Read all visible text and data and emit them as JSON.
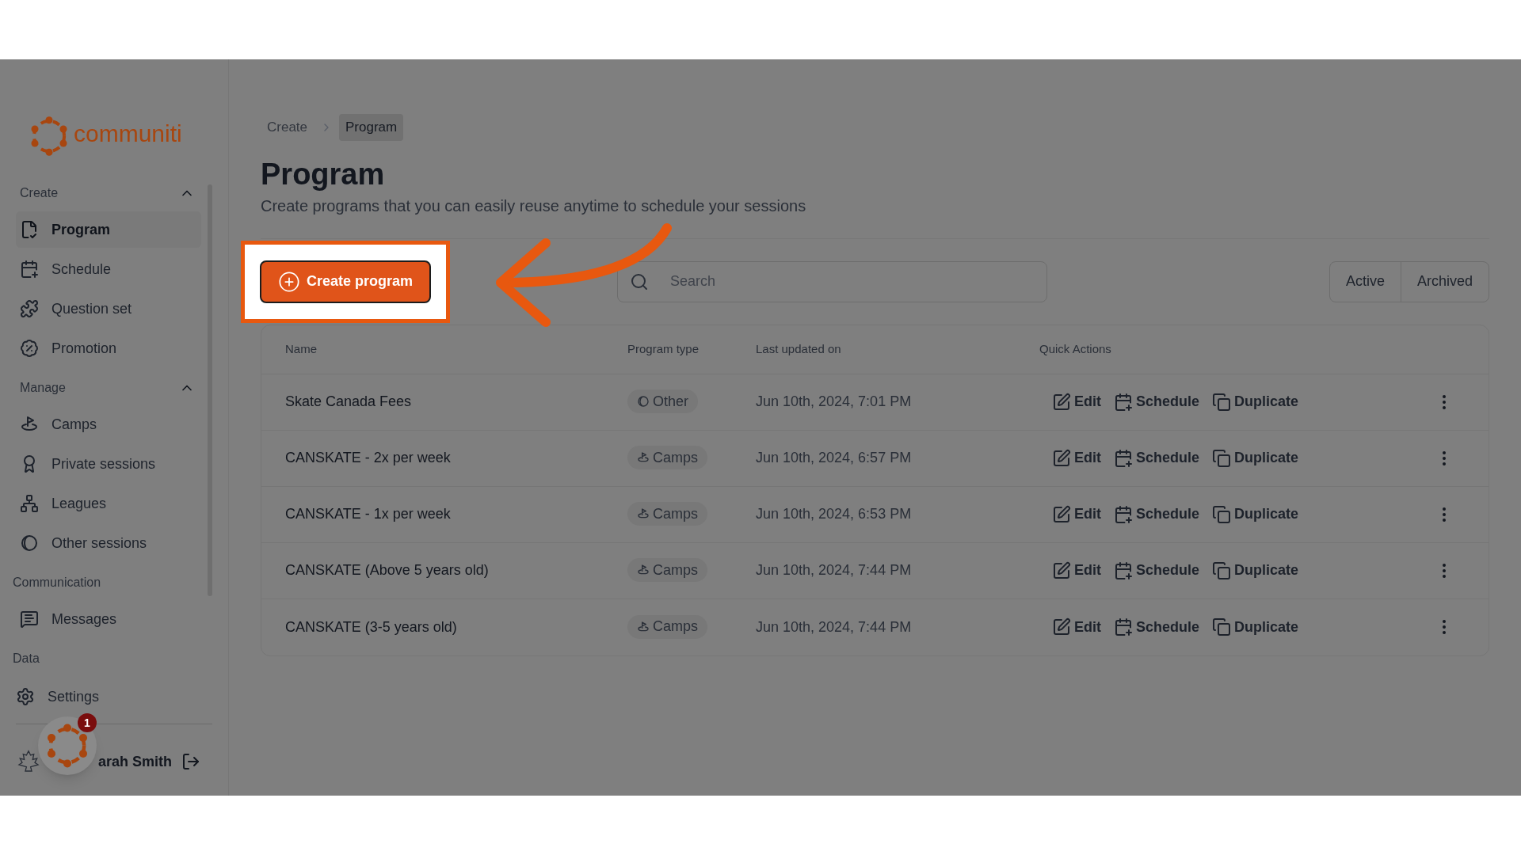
{
  "sidebar": {
    "brand": "communiti",
    "sections": [
      {
        "title": "Create",
        "expanded": true,
        "items": [
          {
            "label": "Program",
            "kind": "program",
            "selected": true
          },
          {
            "label": "Schedule",
            "kind": "schedule",
            "selected": false
          },
          {
            "label": "Question set",
            "kind": "puzzle",
            "selected": false
          },
          {
            "label": "Promotion",
            "kind": "percent",
            "selected": false
          }
        ]
      },
      {
        "title": "Manage",
        "expanded": true,
        "items": [
          {
            "label": "Camps",
            "kind": "camp",
            "selected": false
          },
          {
            "label": "Private sessions",
            "kind": "award",
            "selected": false
          },
          {
            "label": "Leagues",
            "kind": "network",
            "selected": false
          },
          {
            "label": "Other sessions",
            "kind": "half",
            "selected": false
          }
        ]
      },
      {
        "title": "Communication",
        "items": [
          {
            "label": "Messages",
            "kind": "message",
            "selected": false
          }
        ]
      },
      {
        "title": "Data"
      }
    ],
    "settings": "Settings",
    "user": {
      "name": "arah Smith"
    },
    "widget_badge": "1"
  },
  "breadcrumb": [
    {
      "label": "Create",
      "selected": false
    },
    {
      "label": "Program",
      "selected": true
    }
  ],
  "page": {
    "title": "Program",
    "subtitle": "Create programs that you can easily reuse anytime to schedule your sessions"
  },
  "create_button": "Create program",
  "search": {
    "placeholder": "Search"
  },
  "filter_tabs": [
    {
      "label": "Active"
    },
    {
      "label": "Archived"
    }
  ],
  "table": {
    "columns": [
      "Name",
      "Program type",
      "Last updated on",
      "Quick Actions"
    ],
    "rows": [
      {
        "name": "Skate Canada Fees",
        "type": {
          "kind": "other",
          "label": "Other"
        },
        "updated": "Jun 10th, 2024, 7:01 PM",
        "actions": [
          "Edit",
          "Schedule",
          "Duplicate"
        ]
      },
      {
        "name": "CANSKATE - 2x per week",
        "type": {
          "kind": "camps",
          "label": "Camps"
        },
        "updated": "Jun 10th, 2024, 6:57 PM",
        "actions": [
          "Edit",
          "Schedule",
          "Duplicate"
        ]
      },
      {
        "name": "CANSKATE - 1x per week",
        "type": {
          "kind": "camps",
          "label": "Camps"
        },
        "updated": "Jun 10th, 2024, 6:53 PM",
        "actions": [
          "Edit",
          "Schedule",
          "Duplicate"
        ]
      },
      {
        "name": "CANSKATE (Above 5 years old)",
        "type": {
          "kind": "camps",
          "label": "Camps"
        },
        "updated": "Jun 10th, 2024, 7:44 PM",
        "actions": [
          "Edit",
          "Schedule",
          "Duplicate"
        ]
      },
      {
        "name": "CANSKATE (3-5 years old)",
        "type": {
          "kind": "camps",
          "label": "Camps"
        },
        "updated": "Jun 10th, 2024, 7:44 PM",
        "actions": [
          "Edit",
          "Schedule",
          "Duplicate"
        ]
      }
    ]
  }
}
